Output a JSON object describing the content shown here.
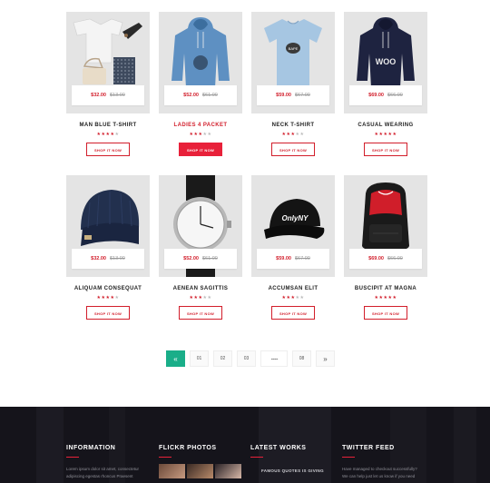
{
  "products": [
    {
      "name": "MAN BLUE T-SHIRT",
      "price": "$32.00",
      "old_price": "$13.00",
      "stars": 4,
      "button": "SHOP IT NOW",
      "highlight": false,
      "image": "clothes-flatlay"
    },
    {
      "name": "LADIES 4 PACKET",
      "price": "$52.00",
      "old_price": "$61.00",
      "stars": 3,
      "button": "SHOP IT NOW",
      "highlight": true,
      "image": "blue-hoodie"
    },
    {
      "name": "NECK T-SHIRT",
      "price": "$59.00",
      "old_price": "$67.00",
      "stars": 3,
      "button": "SHOP IT NOW",
      "highlight": false,
      "image": "light-blue-tshirt"
    },
    {
      "name": "CASUAL WEARING",
      "price": "$69.00",
      "old_price": "$66.00",
      "stars": 5,
      "button": "SHOP IT NOW",
      "highlight": false,
      "image": "navy-hoodie"
    },
    {
      "name": "ALIQUAM CONSEQUAT",
      "price": "$32.00",
      "old_price": "$13.00",
      "stars": 4,
      "button": "SHOP IT NOW",
      "highlight": false,
      "image": "beanie"
    },
    {
      "name": "AENEAN SAGITTIS",
      "price": "$52.00",
      "old_price": "$61.00",
      "stars": 3,
      "button": "SHOP IT NOW",
      "highlight": false,
      "image": "wrist-watch"
    },
    {
      "name": "ACCUMSAN ELIT",
      "price": "$59.00",
      "old_price": "$67.00",
      "stars": 3,
      "button": "SHOP IT NOW",
      "highlight": false,
      "image": "snapback-cap"
    },
    {
      "name": "BUSCIPIT AT MAGNA",
      "price": "$69.00",
      "old_price": "$66.00",
      "stars": 5,
      "button": "SHOP IT NOW",
      "highlight": false,
      "image": "backpack"
    }
  ],
  "pagination": {
    "prev": "«",
    "pages": [
      "01",
      "02",
      "03"
    ],
    "ellipsis": "...........",
    "last": "08",
    "next": "»"
  },
  "footer": {
    "columns": [
      {
        "heading": "INFORMATION",
        "lines": [
          "Lorem ipsum dolor sit amet, consectetur",
          "adipiscing egestas rhoncus Praesent"
        ]
      },
      {
        "heading": "FLICKR PHOTOS"
      },
      {
        "heading": "LATEST WORKS",
        "text": "FAMOUS QUOTES IS GIVING"
      },
      {
        "heading": "TWITTER FEED",
        "lines": [
          "Have managed to checkout successfully?",
          "We can help just let us know if you need"
        ]
      }
    ]
  },
  "colors": {
    "accent": "#d21e2b",
    "button_fill": "#e8213a",
    "pagination_active": "#1aae89",
    "footer_bg": "#14131a"
  }
}
